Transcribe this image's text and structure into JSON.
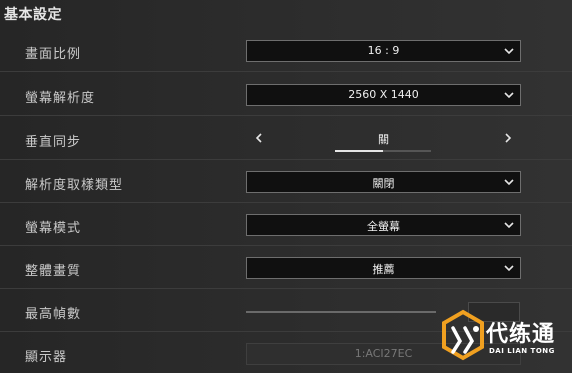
{
  "section_title": "基本設定",
  "settings": {
    "aspect_ratio": {
      "label": "畫面比例",
      "value": "16 : 9"
    },
    "resolution": {
      "label": "螢幕解析度",
      "value": "2560 X 1440"
    },
    "vsync": {
      "label": "垂直同步",
      "value": "關",
      "progress": 0.5
    },
    "upscaling": {
      "label": "解析度取樣類型",
      "value": "關閉"
    },
    "display_mode": {
      "label": "螢幕模式",
      "value": "全螢幕"
    },
    "quality_preset": {
      "label": "整體畫質",
      "value": "推薦"
    },
    "max_fps": {
      "label": "最高幀數"
    },
    "monitor": {
      "label": "顯示器",
      "value": "1:ACI27EC"
    }
  },
  "watermark": {
    "text": "代练通",
    "sub": "DAI LIAN TONG"
  },
  "colors": {
    "background": "#2a2a2a",
    "dropdown_bg": "#101010",
    "dropdown_border": "#6e6e6e",
    "logo_orange": "#f0a020"
  }
}
